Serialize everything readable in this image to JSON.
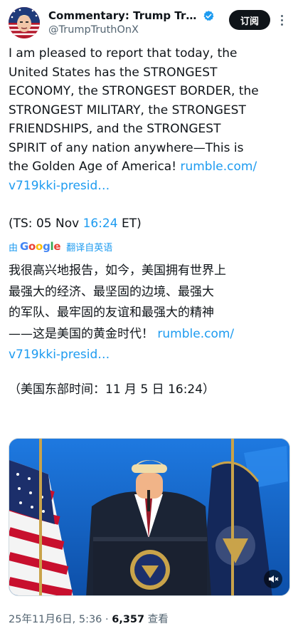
{
  "header": {
    "display_name": "Commentary: Trump Trut…",
    "handle": "@TrumpTruthOnX",
    "subscribe_label": "订阅"
  },
  "post": {
    "lines": [
      "I am pleased to report that today, the",
      "United States has the STRONGEST",
      "ECONOMY, the STRONGEST BORDER, the",
      "STRONGEST MILITARY, the STRONGEST",
      "FRIENDSHIPS, and the STRONGEST",
      "SPIRIT of any nation anywhere—This is"
    ],
    "last_line_text": "the Golden Age of America! ",
    "link_part1": "rumble.com/",
    "link_part2": "v719kki-presid…",
    "ts_prefix": "(TS: 05 Nov ",
    "ts_time": "16:24",
    "ts_suffix": " ET)"
  },
  "translation": {
    "by": "由",
    "google": [
      "G",
      "o",
      "o",
      "g",
      "l",
      "e"
    ],
    "action": "翻译自英语",
    "lines": [
      "我很高兴地报告，如今，美国拥有世界上",
      "最强大的经济、最坚固的边境、最强大",
      "的军队、最牢固的友谊和最强大的精神"
    ],
    "line4_text": "——这是美国的黄金时代！ ",
    "link_part1": "rumble.com/",
    "link_part2": "v719kki-presid…",
    "timestamp": "（美国东部时间：11 月 5 日 16:24）"
  },
  "meta": {
    "date": "25年11月6日, 5:36",
    "separator": " · ",
    "views_count": "6,357",
    "views_label": " 查看"
  },
  "colors": {
    "link": "#1d9bf0",
    "verified": "#1d9bf0",
    "stage_blue": "#1766c8"
  }
}
